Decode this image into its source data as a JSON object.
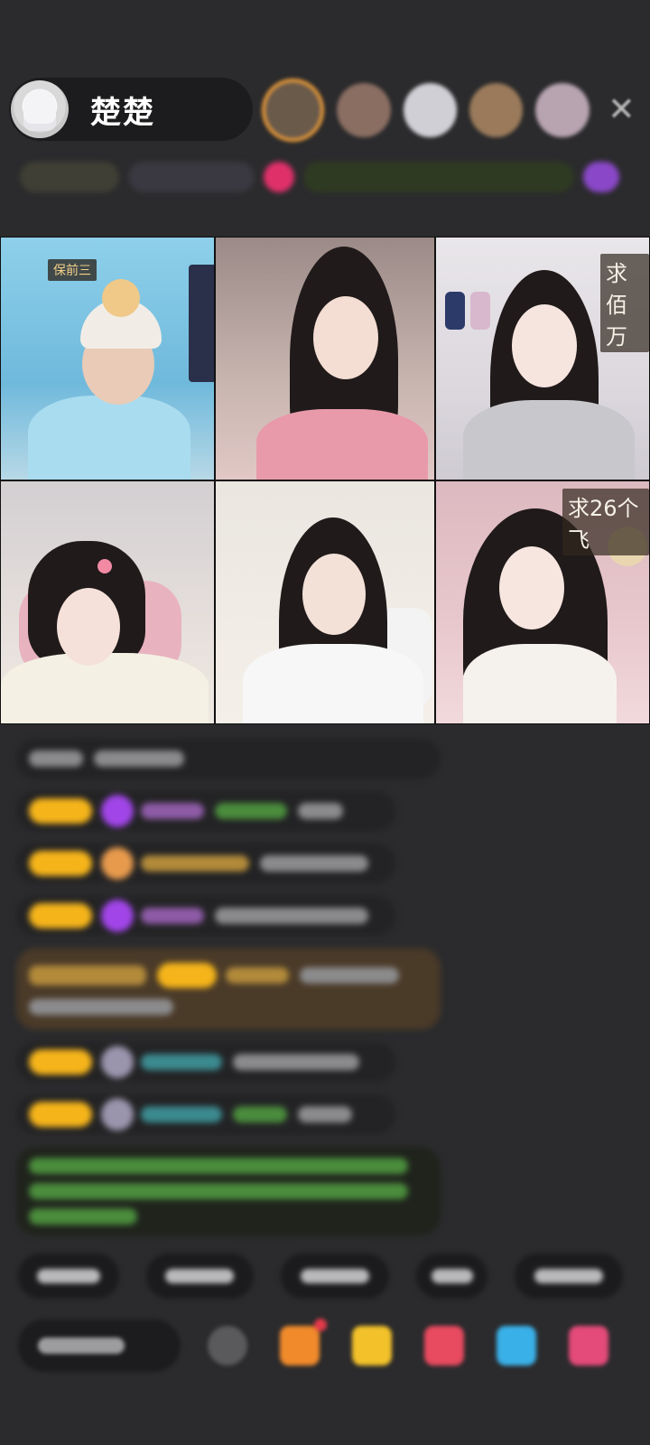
{
  "host": {
    "name": "楚楚"
  },
  "viewers": {
    "close_icon": "✕"
  },
  "tiles": [
    {
      "label": "保前三"
    },
    {
      "label": ""
    },
    {
      "label": "求佰万"
    },
    {
      "label": ""
    },
    {
      "label": ""
    },
    {
      "label": "求26个飞"
    }
  ],
  "icons": {
    "avatar": "avatar-image",
    "close": "close-icon",
    "gift": "gift-icon",
    "emoji": "emoji-icon"
  }
}
